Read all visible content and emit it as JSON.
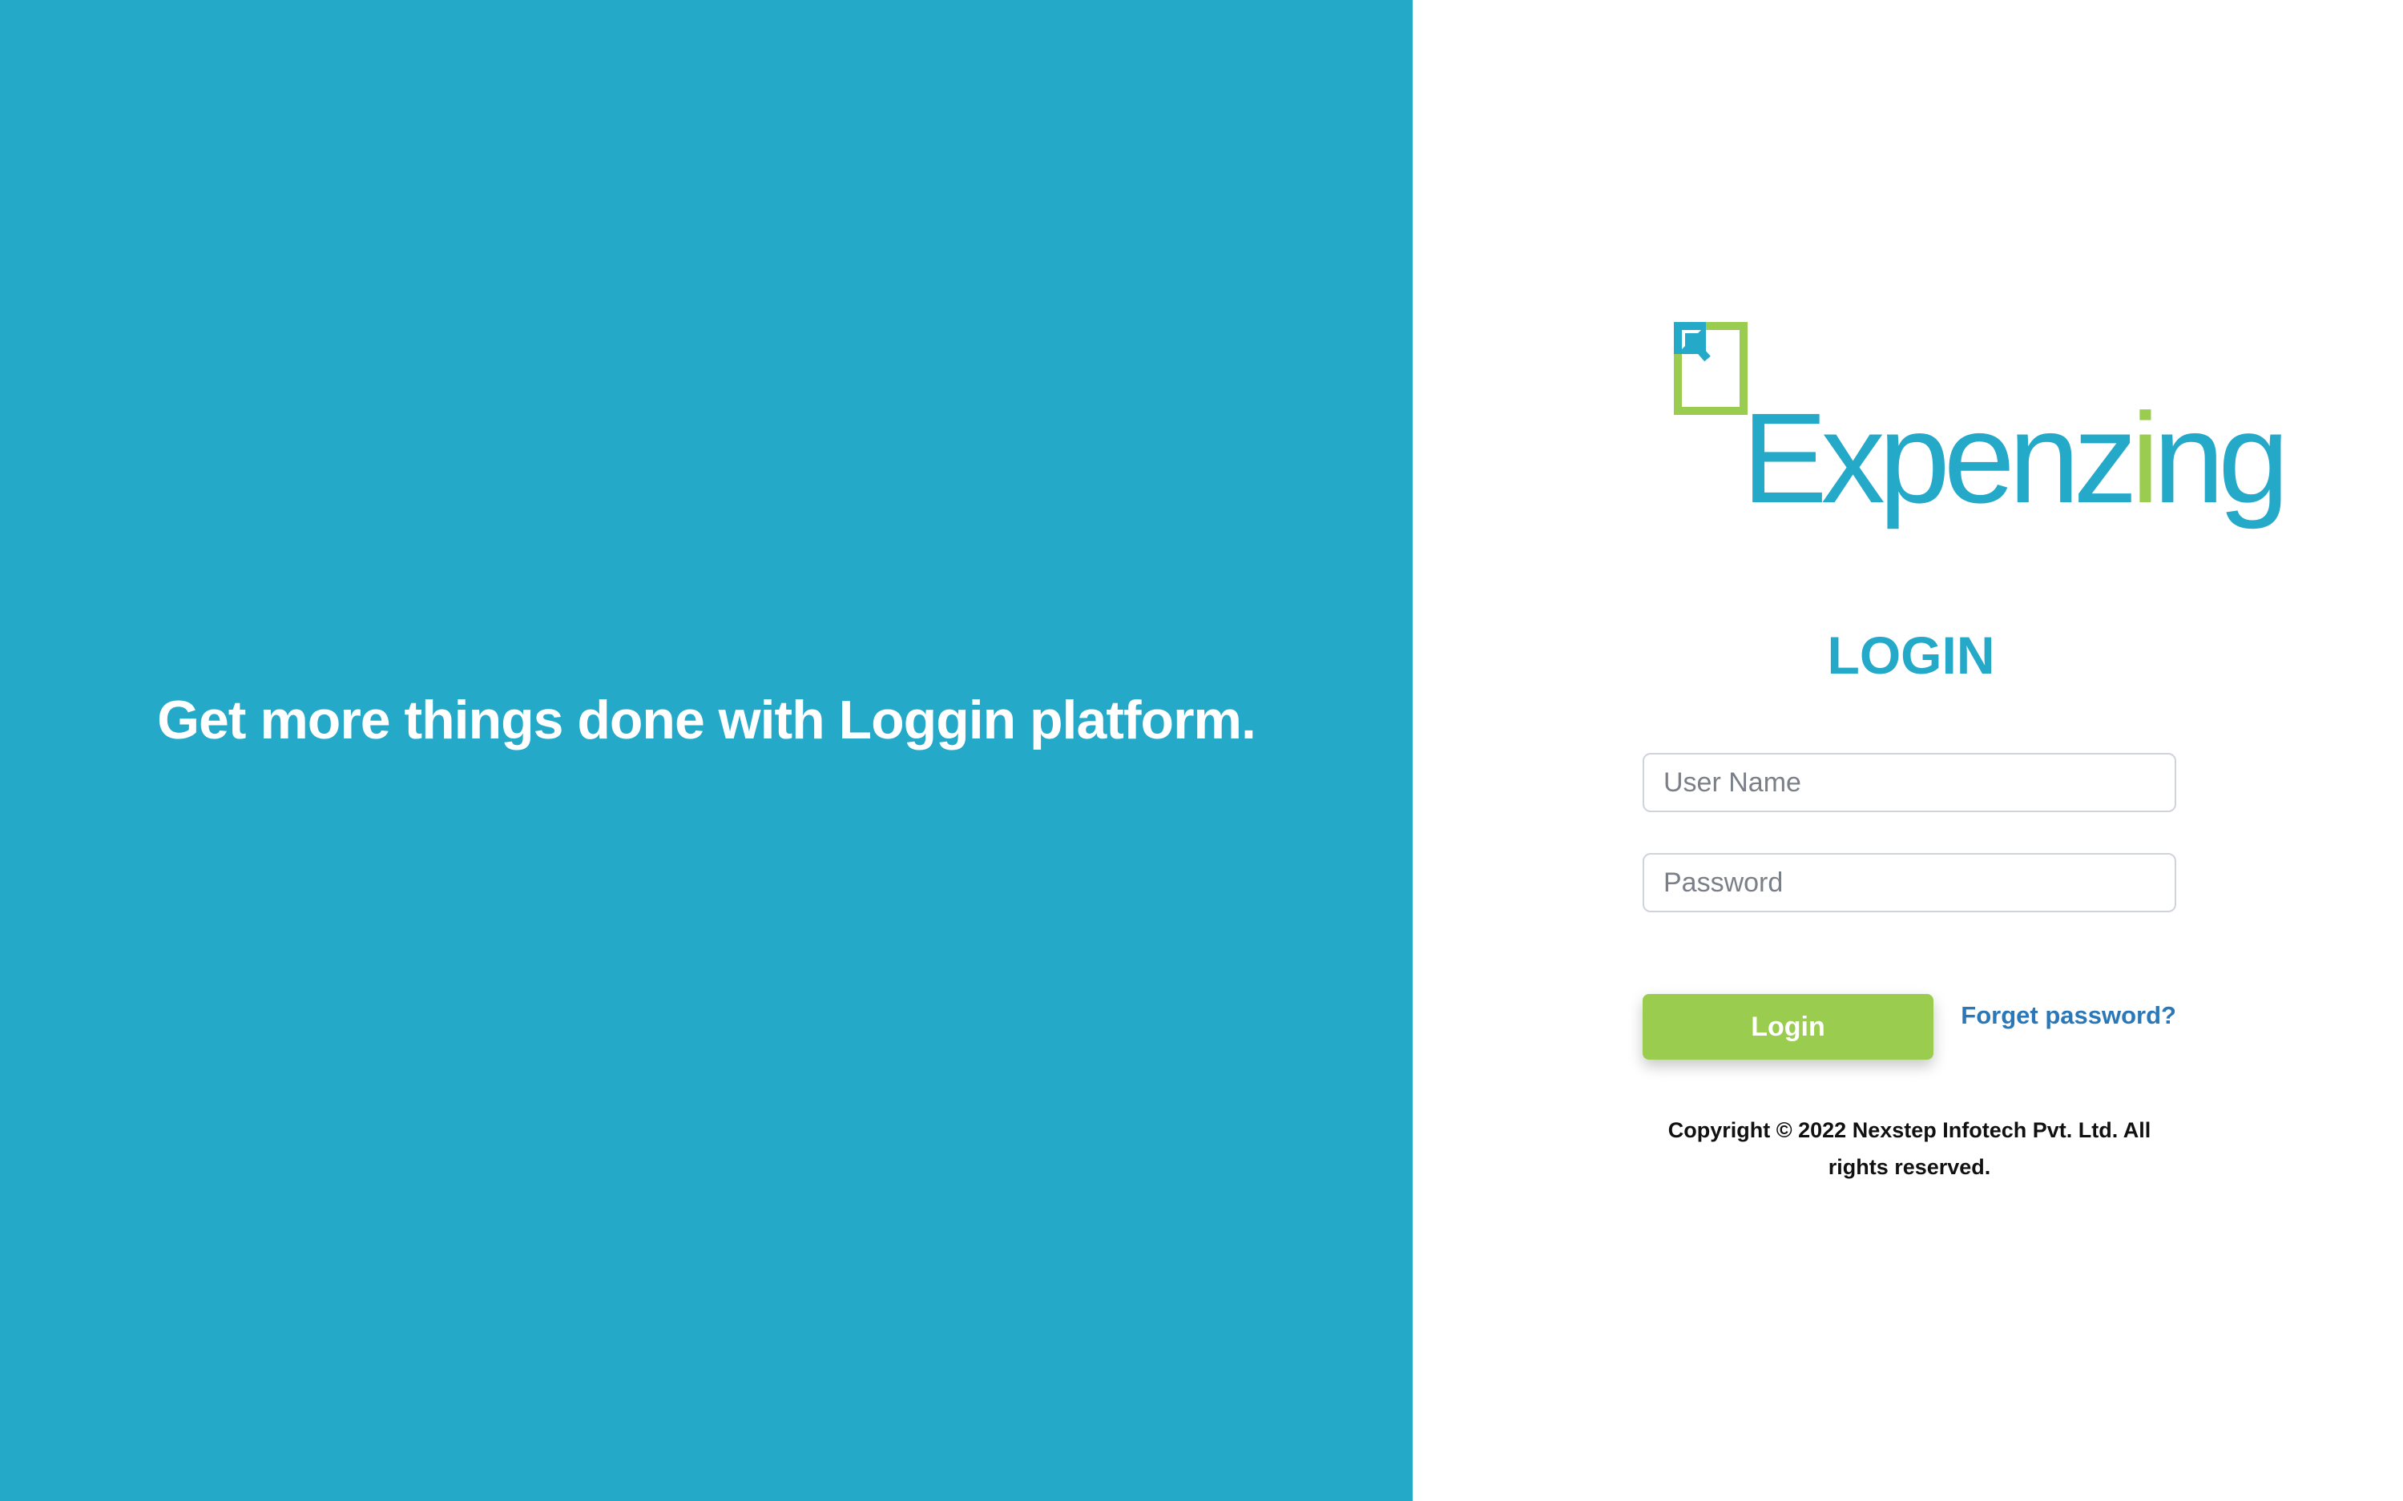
{
  "left_panel": {
    "tagline": "Get more things done with Loggin platform.",
    "background_color": "#25a9c9"
  },
  "logo": {
    "text_part1": "Expenz",
    "text_accent": "i",
    "text_part2": "ng",
    "icon": "expand-arrow-icon",
    "brand_blue": "#25a9c9",
    "brand_green": "#9acd4f"
  },
  "login_form": {
    "title": "LOGIN",
    "username_placeholder": "User Name",
    "username_value": "",
    "password_placeholder": "Password",
    "password_value": "",
    "login_button_label": "Login",
    "forgot_password_label": "Forget password?"
  },
  "footer": {
    "copyright": "Copyright © 2022 Nexstep Infotech Pvt. Ltd. All rights reserved."
  }
}
